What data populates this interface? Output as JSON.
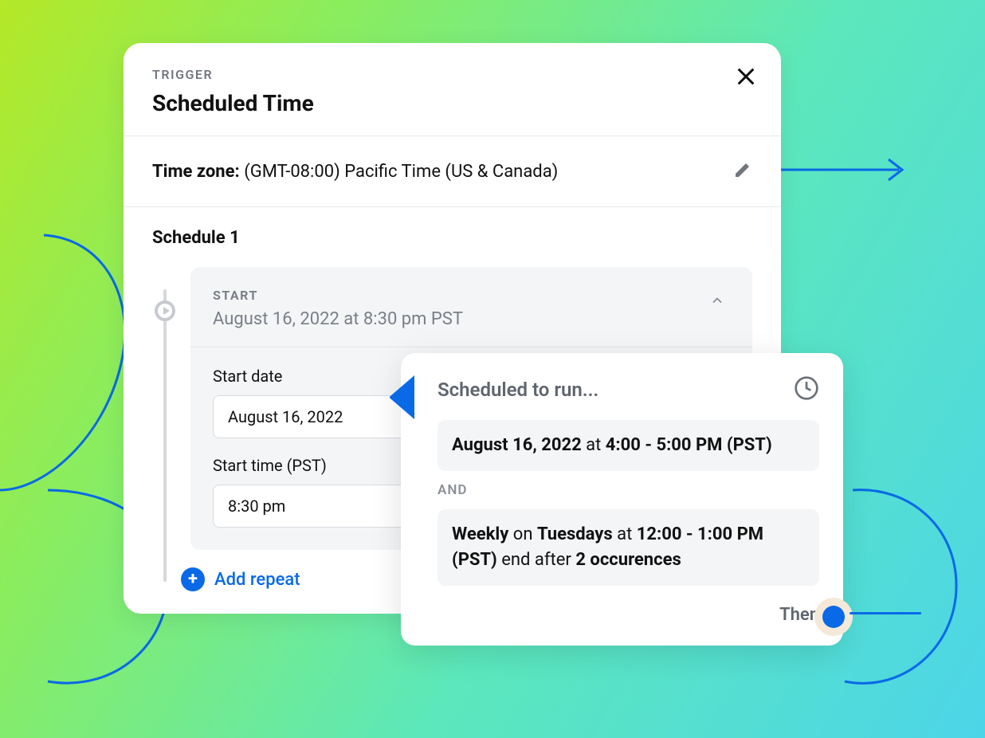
{
  "header": {
    "eyebrow": "TRIGGER",
    "title": "Scheduled Time"
  },
  "timezone": {
    "label": "Time zone:",
    "value": "(GMT-08:00) Pacific Time (US & Canada)"
  },
  "schedule": {
    "title": "Schedule 1",
    "start": {
      "label": "START",
      "summary": "August 16, 2022 at 8:30 pm PST",
      "date_label": "Start date",
      "date_value": "August 16, 2022",
      "time_label": "Start time (PST)",
      "time_value": "8:30 pm"
    },
    "add_repeat": "Add repeat"
  },
  "popup": {
    "title": "Scheduled to run...",
    "item1": {
      "date": "August 16, 2022",
      "at": " at ",
      "range": "4:00 - 5:00 PM (PST)"
    },
    "and": "AND",
    "item2": {
      "freq": "Weekly",
      "on": " on ",
      "day": "Tuesdays",
      "at": " at ",
      "range": "12:00 - 1:00 PM (PST)",
      "end": " end after ",
      "occ": "2 occurences"
    },
    "then": "Then"
  }
}
